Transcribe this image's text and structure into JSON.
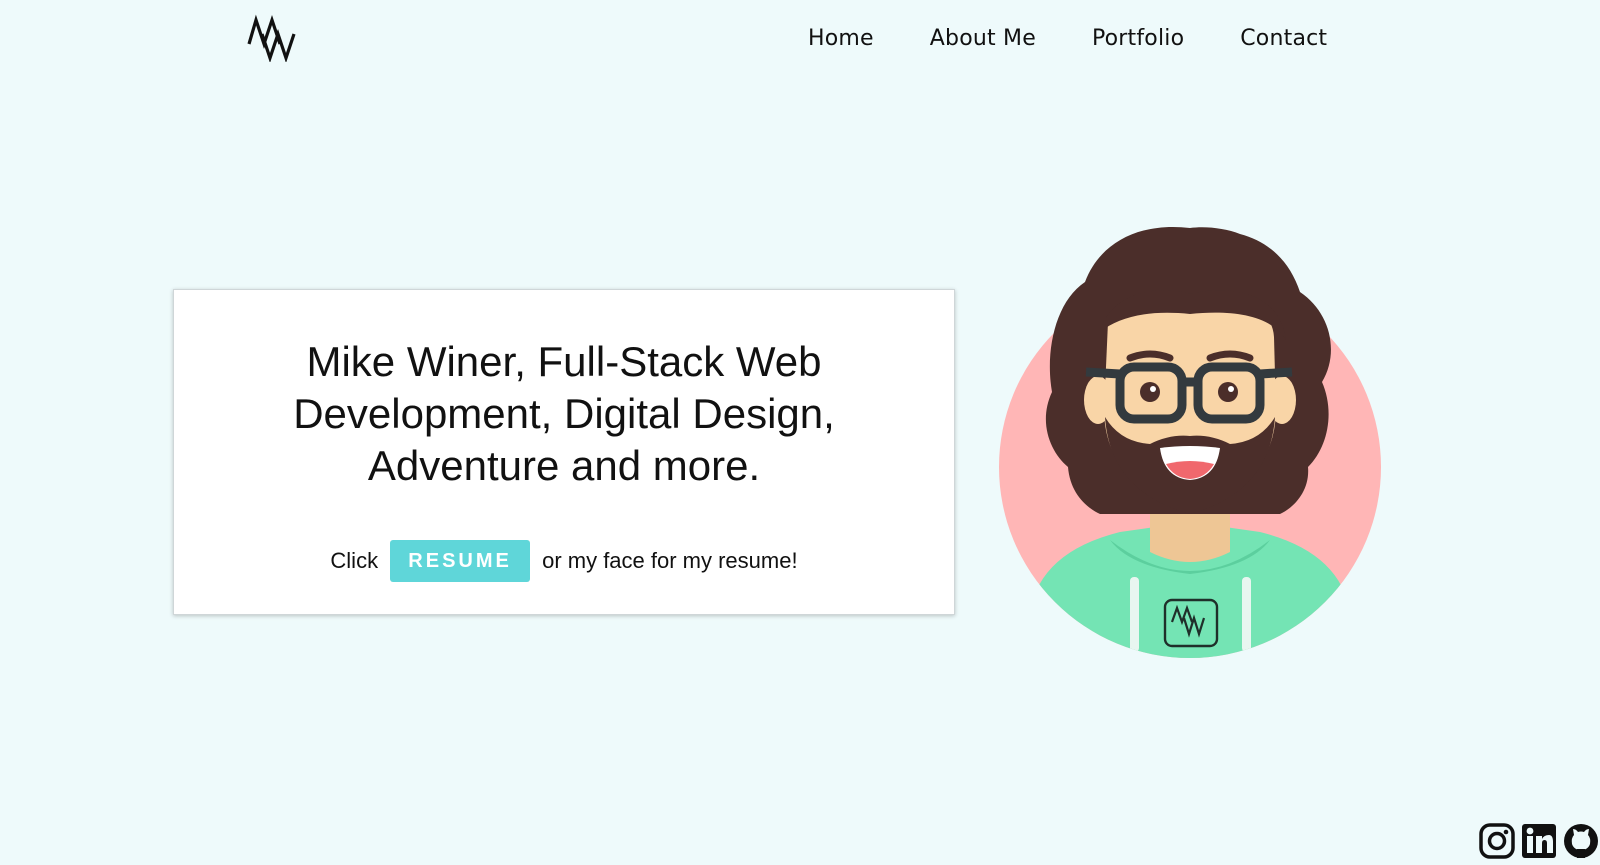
{
  "nav": {
    "logo_text": "MW",
    "items": [
      {
        "label": "Home"
      },
      {
        "label": "About Me"
      },
      {
        "label": "Portfolio"
      },
      {
        "label": "Contact"
      }
    ]
  },
  "hero": {
    "headline": "Mike Winer, Full-Stack Web Development, Digital Design, Adventure and more.",
    "cta_prefix": "Click",
    "resume_button": "RESUME",
    "cta_suffix": "or my face for my resume!"
  },
  "avatar": {
    "hoodie_logo_text": "MW",
    "colors": {
      "circle": "#ffb6b6",
      "hair": "#4b2e2a",
      "skin": "#f9d5a7",
      "hoodie": "#74e4b4"
    }
  },
  "social": {
    "icons": [
      "instagram-icon",
      "linkedin-icon",
      "github-icon"
    ]
  },
  "colors": {
    "background": "#eefafb",
    "accent": "#5fd6d9",
    "text": "#111111"
  }
}
